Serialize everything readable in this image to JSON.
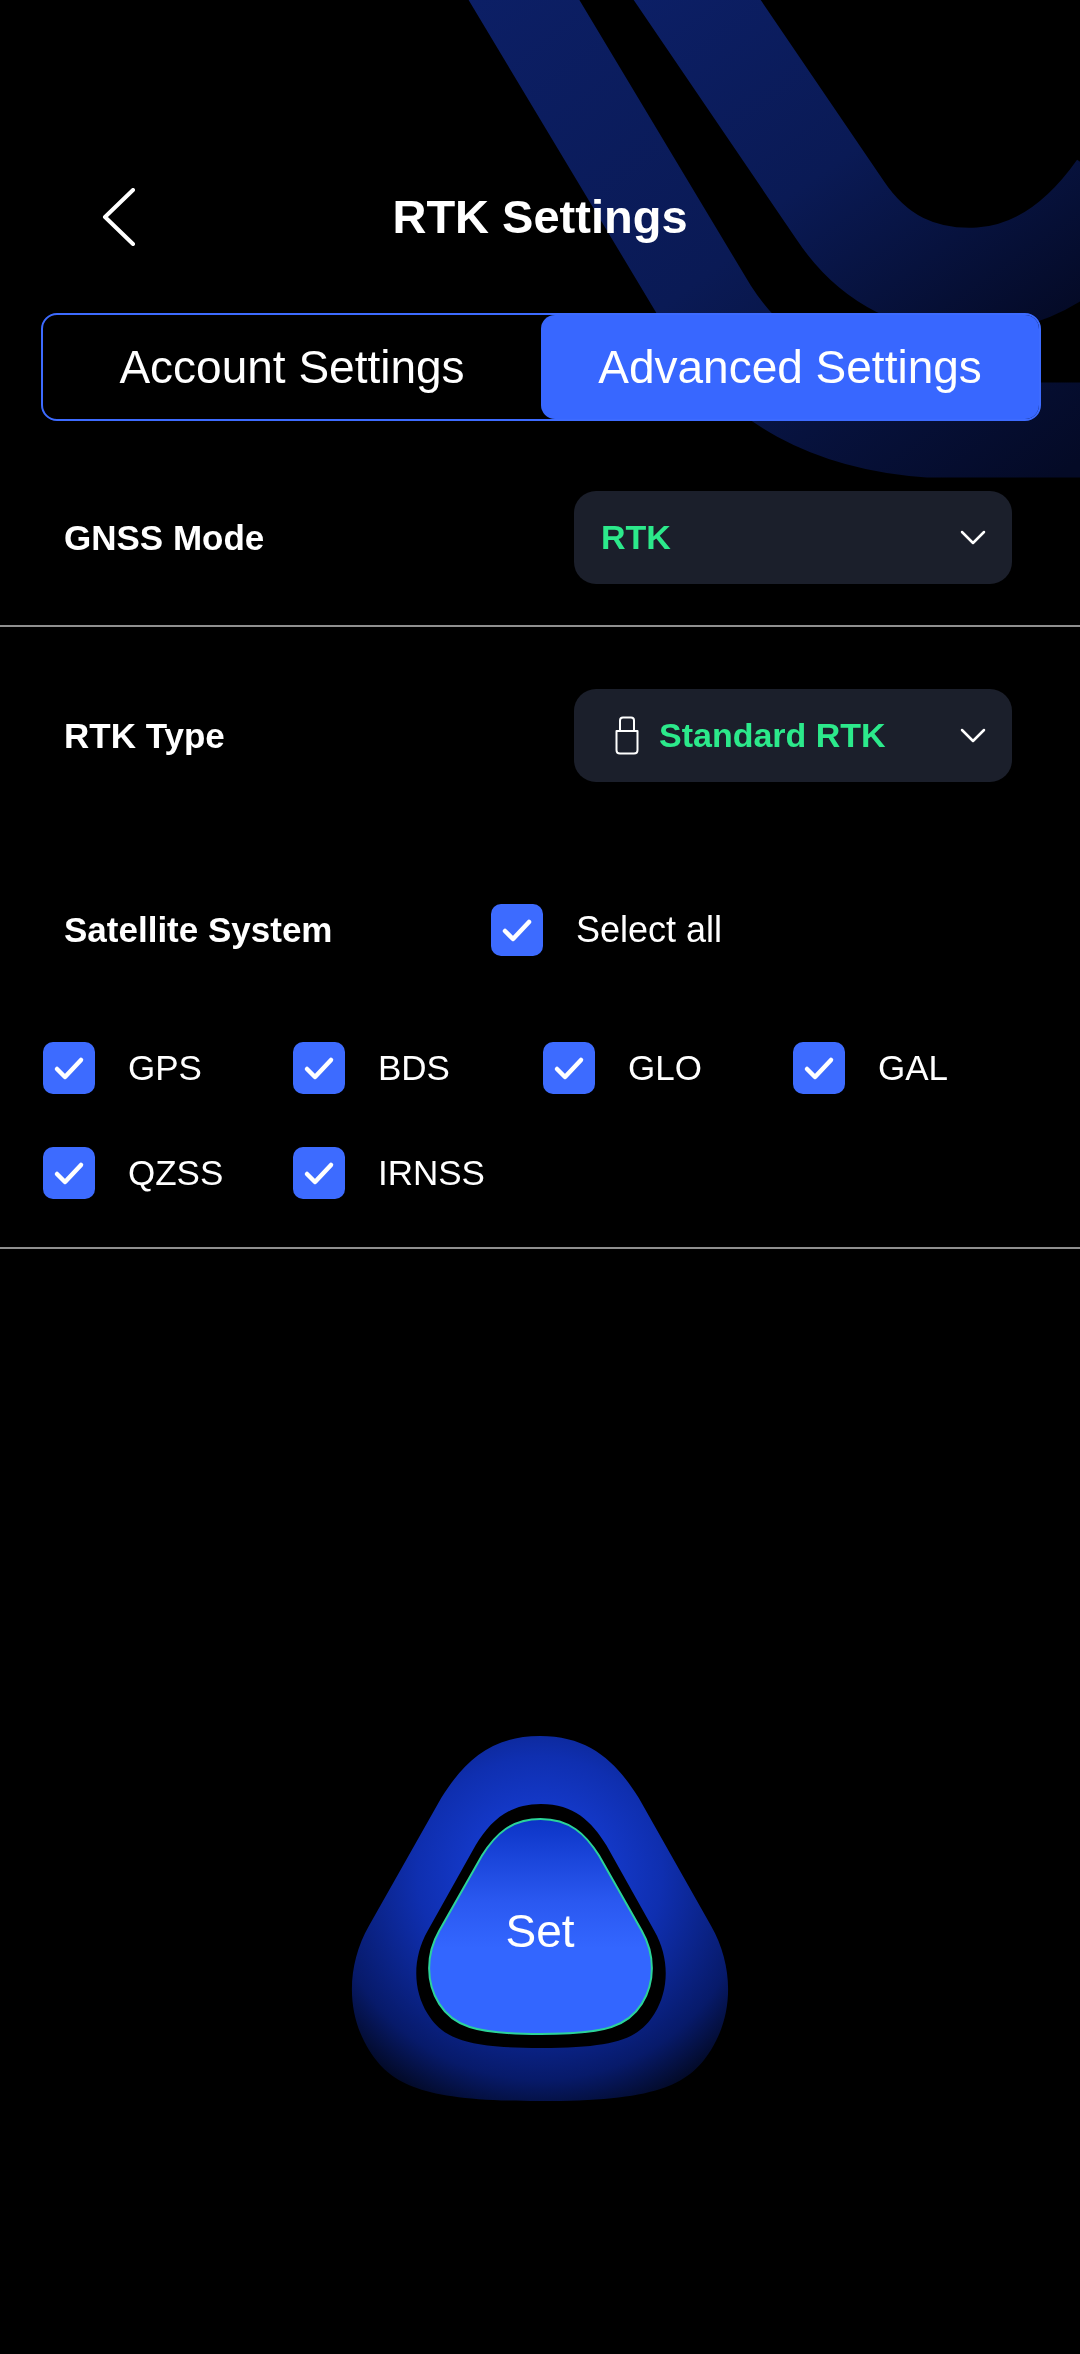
{
  "header": {
    "title": "RTK Settings"
  },
  "tabs": [
    {
      "label": "Account Settings",
      "selected": false
    },
    {
      "label": "Advanced Settings",
      "selected": true
    }
  ],
  "settings": [
    {
      "kind": "dropdown",
      "label": "GNSS Mode",
      "value": "RTK"
    },
    {
      "kind": "icon_dropdown",
      "label": "RTK Type",
      "value": "Standard RTK"
    }
  ],
  "satellite_system": {
    "label": "Satellite System",
    "select_all": {
      "label": "Select all",
      "checked": true
    },
    "systems": [
      {
        "label": "GPS",
        "checked": true
      },
      {
        "label": "BDS",
        "checked": true
      },
      {
        "label": "GLO",
        "checked": true
      },
      {
        "label": "GAL",
        "checked": true
      },
      {
        "label": "QZSS",
        "checked": true
      },
      {
        "label": "IRNSS",
        "checked": true
      }
    ]
  },
  "set_button": {
    "label": "Set"
  }
}
